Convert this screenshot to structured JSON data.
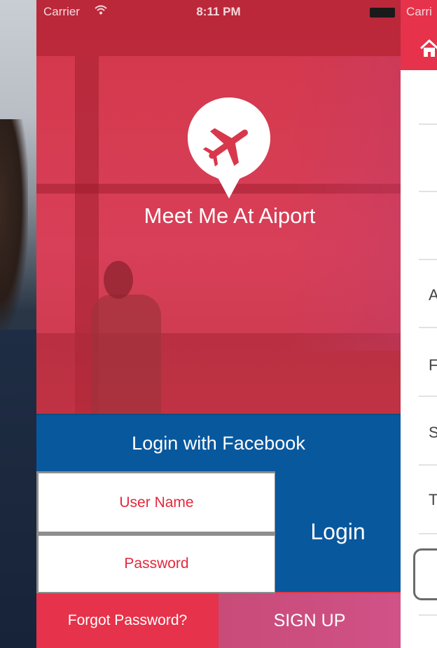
{
  "status_bar": {
    "carrier": "Carrier",
    "time": "8:11 PM"
  },
  "app": {
    "title": "Meet Me At Aiport",
    "logo_icon": "airplane-pin-icon"
  },
  "login": {
    "facebook_label": "Login with Facebook",
    "username_placeholder": "User Name",
    "password_placeholder": "Password",
    "login_label": "Login",
    "forgot_label": "Forgot Password?",
    "signup_label": "SIGN UP"
  },
  "right_panel": {
    "carrier": "Carri",
    "home_icon": "home-icon",
    "row_letters": [
      "A",
      "F",
      "S",
      "T"
    ]
  },
  "colors": {
    "brand_red": "#e6324a",
    "facebook_blue": "#08589e",
    "signup_pink": "#d05287",
    "placeholder_red": "#e4283d"
  }
}
